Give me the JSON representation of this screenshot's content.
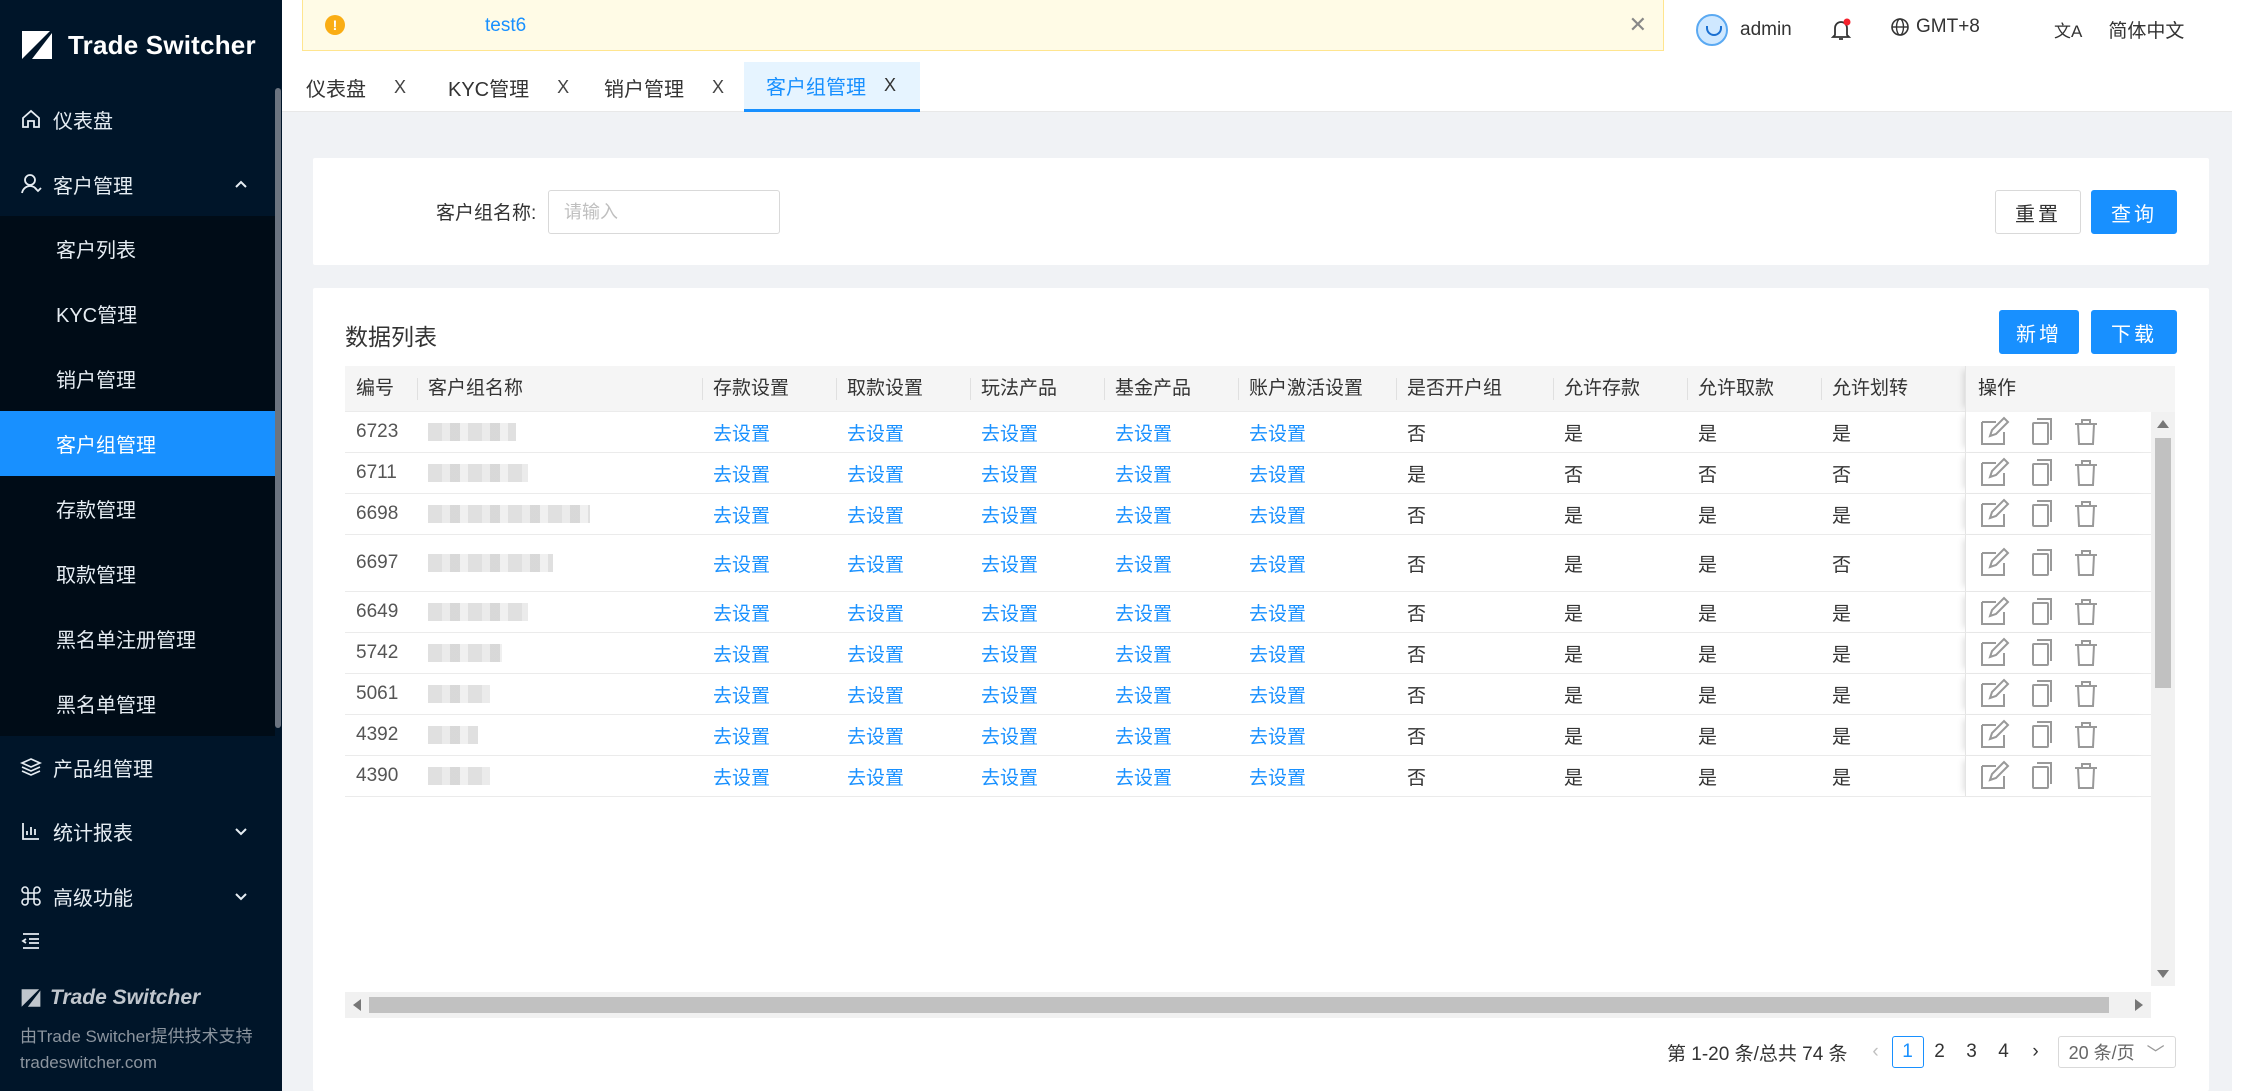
{
  "app": {
    "brand": "Trade Switcher"
  },
  "sidebar": {
    "items": [
      {
        "label": "仪表盘",
        "icon": "home-icon"
      },
      {
        "label": "客户管理",
        "icon": "user-icon",
        "expanded": true
      },
      {
        "label": "产品组管理",
        "icon": "layers-icon"
      },
      {
        "label": "统计报表",
        "icon": "bar-chart-icon"
      },
      {
        "label": "高级功能",
        "icon": "command-icon"
      }
    ],
    "sub_items": [
      {
        "label": "客户列表"
      },
      {
        "label": "KYC管理"
      },
      {
        "label": "销户管理"
      },
      {
        "label": "客户组管理",
        "active": true
      },
      {
        "label": "存款管理"
      },
      {
        "label": "取款管理"
      },
      {
        "label": "黑名单注册管理"
      },
      {
        "label": "黑名单管理"
      }
    ],
    "footer_brand": "Trade Switcher",
    "footer_support": "由Trade Switcher提供技术支持",
    "footer_site": "tradeswitcher.com"
  },
  "topbar": {
    "notice": "test6",
    "user": "admin",
    "timezone": "GMT+8",
    "language": "简体中文"
  },
  "tabs": [
    {
      "label": "仪表盘",
      "close": "X"
    },
    {
      "label": "KYC管理",
      "close": "X"
    },
    {
      "label": "销户管理",
      "close": "X"
    },
    {
      "label": "客户组管理",
      "close": "X",
      "active": true
    }
  ],
  "search": {
    "label": "客户组名称:",
    "placeholder": "请输入",
    "reset": "重置",
    "query": "查询"
  },
  "list": {
    "title": "数据列表",
    "add": "新增",
    "download": "下载"
  },
  "table": {
    "columns": [
      "编号",
      "客户组名称",
      "存款设置",
      "取款设置",
      "玩法产品",
      "基金产品",
      "账户激活设置",
      "是否开户组",
      "允许存款",
      "允许取款",
      "允许划转",
      "操作"
    ],
    "rows": [
      {
        "id": "6723",
        "link": "去设置",
        "open": "否",
        "deposit": "是",
        "withdraw": "是",
        "transfer": "是"
      },
      {
        "id": "6711",
        "link": "去设置",
        "open": "是",
        "deposit": "否",
        "withdraw": "否",
        "transfer": "否"
      },
      {
        "id": "6698",
        "link": "去设置",
        "open": "否",
        "deposit": "是",
        "withdraw": "是",
        "transfer": "是"
      },
      {
        "id": "6697",
        "link": "去设置",
        "open": "否",
        "deposit": "是",
        "withdraw": "是",
        "transfer": "否"
      },
      {
        "id": "6649",
        "link": "去设置",
        "open": "否",
        "deposit": "是",
        "withdraw": "是",
        "transfer": "是"
      },
      {
        "id": "5742",
        "link": "去设置",
        "open": "否",
        "deposit": "是",
        "withdraw": "是",
        "transfer": "是"
      },
      {
        "id": "5061",
        "link": "去设置",
        "open": "否",
        "deposit": "是",
        "withdraw": "是",
        "transfer": "是"
      },
      {
        "id": "4392",
        "link": "去设置",
        "open": "否",
        "deposit": "是",
        "withdraw": "是",
        "transfer": "是"
      },
      {
        "id": "4390",
        "link": "去设置",
        "open": "否",
        "deposit": "是",
        "withdraw": "是",
        "transfer": "是"
      }
    ]
  },
  "pagination": {
    "summary": "第 1-20 条/总共 74 条",
    "pages": [
      "1",
      "2",
      "3",
      "4"
    ],
    "current": "1",
    "page_size": "20 条/页"
  },
  "colors": {
    "primary": "#1890ff",
    "sidebar": "#001529",
    "notice_bg": "#fffbe6"
  }
}
